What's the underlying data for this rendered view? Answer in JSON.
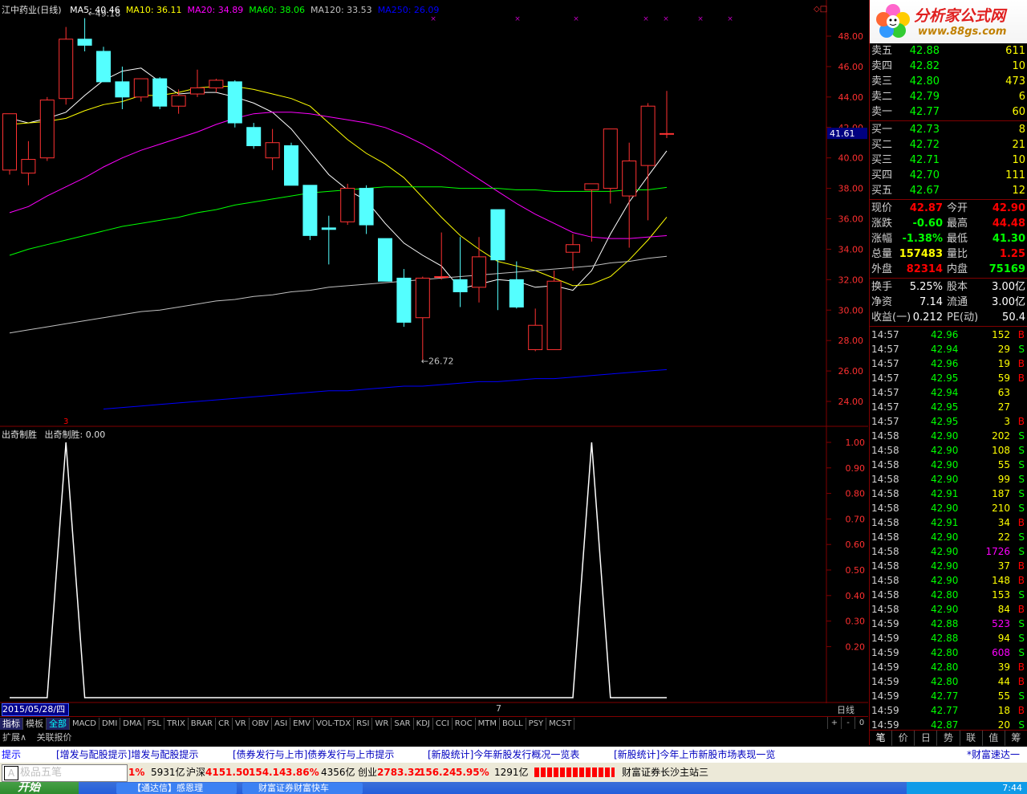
{
  "header": {
    "title": "江中药业(日线)",
    "ma": [
      {
        "label": "MA5: 40.46",
        "color": "#ffffff"
      },
      {
        "label": "MA10: 36.11",
        "color": "#ffff00"
      },
      {
        "label": "MA20: 34.89",
        "color": "#ff00ff"
      },
      {
        "label": "MA60: 38.06",
        "color": "#00ff00"
      },
      {
        "label": "MA120: 33.53",
        "color": "#c0c0c0"
      },
      {
        "label": "MA250: 26.09",
        "color": "#0000ff"
      }
    ]
  },
  "price_axis": [
    "48.00",
    "46.00",
    "44.00",
    "42.00",
    "40.00",
    "38.00",
    "36.00",
    "34.00",
    "32.00",
    "30.00",
    "28.00",
    "26.00",
    "24.00"
  ],
  "price_marker": "41.61",
  "annotations": {
    "high": "49.18",
    "low": "26.72"
  },
  "indicator": {
    "title": "出奇制胜",
    "value_label": "出奇制胜: 0.00",
    "axis": [
      "1.00",
      "0.90",
      "0.80",
      "0.70",
      "0.60",
      "0.50",
      "0.40",
      "0.30",
      "0.20"
    ],
    "signal_marker": "3"
  },
  "date_label": "2015/05/28/四",
  "month_marker": "7",
  "period_label": "日线",
  "chart_data": {
    "type": "candlestick",
    "title": "江中药业(日线)",
    "ylim": [
      23.0,
      49.5
    ],
    "candles": [
      {
        "o": 39.2,
        "h": 42.9,
        "l": 38.9,
        "c": 42.9
      },
      {
        "o": 39.0,
        "h": 41.1,
        "l": 38.2,
        "c": 39.9
      },
      {
        "o": 40.0,
        "h": 44.0,
        "l": 39.8,
        "c": 43.8
      },
      {
        "o": 43.9,
        "h": 48.6,
        "l": 43.5,
        "c": 47.8
      },
      {
        "o": 47.8,
        "h": 49.18,
        "l": 47.0,
        "c": 47.4
      },
      {
        "o": 47.0,
        "h": 47.3,
        "l": 45.0,
        "c": 45.0
      },
      {
        "o": 45.0,
        "h": 46.0,
        "l": 43.2,
        "c": 44.0
      },
      {
        "o": 44.0,
        "h": 45.2,
        "l": 43.7,
        "c": 45.2
      },
      {
        "o": 45.2,
        "h": 45.3,
        "l": 43.2,
        "c": 43.4
      },
      {
        "o": 43.4,
        "h": 44.5,
        "l": 42.9,
        "c": 44.1
      },
      {
        "o": 44.2,
        "h": 45.8,
        "l": 44.0,
        "c": 44.6
      },
      {
        "o": 44.6,
        "h": 45.2,
        "l": 44.3,
        "c": 45.1
      },
      {
        "o": 45.0,
        "h": 45.1,
        "l": 42.0,
        "c": 42.3
      },
      {
        "o": 42.0,
        "h": 42.3,
        "l": 40.6,
        "c": 40.8
      },
      {
        "o": 40.0,
        "h": 41.9,
        "l": 39.2,
        "c": 41.0
      },
      {
        "o": 40.8,
        "h": 41.0,
        "l": 38.2,
        "c": 38.2
      },
      {
        "o": 38.2,
        "h": 38.2,
        "l": 34.6,
        "c": 34.9
      },
      {
        "o": 35.4,
        "h": 36.2,
        "l": 33.0,
        "c": 35.3
      },
      {
        "o": 35.8,
        "h": 38.3,
        "l": 35.6,
        "c": 38.0
      },
      {
        "o": 38.0,
        "h": 38.2,
        "l": 35.0,
        "c": 35.6
      },
      {
        "o": 34.7,
        "h": 34.7,
        "l": 31.9,
        "c": 31.9
      },
      {
        "o": 32.1,
        "h": 32.7,
        "l": 28.9,
        "c": 29.2
      },
      {
        "o": 29.5,
        "h": 32.2,
        "l": 26.72,
        "c": 32.1
      },
      {
        "o": 32.2,
        "h": 35.1,
        "l": 32.0,
        "c": 32.2
      },
      {
        "o": 32.0,
        "h": 34.8,
        "l": 30.2,
        "c": 31.2
      },
      {
        "o": 31.5,
        "h": 34.8,
        "l": 30.5,
        "c": 33.5
      },
      {
        "o": 36.6,
        "h": 36.6,
        "l": 30.0,
        "c": 33.3
      },
      {
        "o": 32.0,
        "h": 33.2,
        "l": 30.1,
        "c": 30.2
      },
      {
        "o": 27.4,
        "h": 30.1,
        "l": 27.3,
        "c": 29.0
      },
      {
        "o": 27.4,
        "h": 32.6,
        "l": 27.4,
        "c": 31.9
      },
      {
        "o": 33.8,
        "h": 35.0,
        "l": 32.6,
        "c": 34.3
      },
      {
        "o": 37.9,
        "h": 38.3,
        "l": 34.5,
        "c": 38.3
      },
      {
        "o": 38.0,
        "h": 41.9,
        "l": 37.0,
        "c": 41.9
      },
      {
        "o": 37.5,
        "h": 41.0,
        "l": 34.1,
        "c": 39.8
      },
      {
        "o": 39.5,
        "h": 43.6,
        "l": 35.9,
        "c": 43.4
      },
      {
        "o": 41.6,
        "h": 44.4,
        "l": 41.3,
        "c": 41.6
      }
    ],
    "ma_lines": [
      {
        "name": "MA5",
        "color": "#ffffff",
        "values": [
          42.6,
          42.3,
          42.6,
          43.0,
          44.1,
          45.1,
          45.7,
          45.9,
          45.0,
          44.2,
          44.3,
          44.3,
          44.0,
          43.6,
          43.0,
          41.9,
          40.4,
          38.9,
          37.9,
          37.2,
          35.7,
          34.4,
          33.6,
          32.9,
          31.4,
          31.7,
          32.0,
          31.9,
          31.5,
          31.6,
          31.3,
          32.6,
          35.0,
          37.1,
          38.8,
          40.46
        ]
      },
      {
        "name": "MA10",
        "color": "#ffff00",
        "values": [
          42.2,
          42.3,
          42.4,
          42.6,
          43.1,
          43.5,
          43.7,
          44.1,
          44.1,
          44.3,
          44.6,
          44.7,
          44.7,
          44.5,
          44.2,
          43.9,
          43.4,
          42.3,
          41.2,
          40.3,
          39.6,
          38.7,
          37.4,
          36.1,
          34.9,
          34.0,
          33.2,
          32.9,
          32.6,
          32.1,
          31.6,
          31.7,
          32.2,
          33.3,
          34.6,
          36.11
        ]
      },
      {
        "name": "MA20",
        "color": "#ff00ff",
        "values": [
          36.4,
          36.8,
          37.5,
          38.1,
          38.7,
          39.4,
          40.0,
          40.5,
          40.9,
          41.3,
          41.7,
          42.2,
          42.6,
          42.9,
          43.0,
          43.0,
          42.9,
          42.7,
          42.5,
          42.3,
          42.0,
          41.5,
          40.9,
          40.2,
          39.4,
          38.6,
          37.8,
          37.0,
          36.3,
          35.7,
          35.1,
          34.8,
          34.7,
          34.7,
          34.8,
          34.89
        ]
      },
      {
        "name": "MA60",
        "color": "#00ff00",
        "values": [
          33.6,
          34.0,
          34.3,
          34.6,
          34.9,
          35.2,
          35.5,
          35.7,
          35.9,
          36.1,
          36.4,
          36.6,
          36.9,
          37.1,
          37.3,
          37.5,
          37.7,
          37.8,
          37.9,
          38.0,
          38.1,
          38.1,
          38.1,
          38.1,
          38.0,
          38.0,
          38.0,
          37.9,
          37.9,
          37.8,
          37.8,
          37.8,
          37.8,
          37.9,
          37.9,
          38.06
        ]
      },
      {
        "name": "MA120",
        "color": "#c0c0c0",
        "values": [
          28.5,
          28.7,
          28.9,
          29.1,
          29.3,
          29.5,
          29.7,
          29.9,
          30.0,
          30.2,
          30.4,
          30.6,
          30.7,
          30.9,
          31.0,
          31.2,
          31.3,
          31.5,
          31.6,
          31.7,
          31.8,
          31.9,
          32.0,
          32.1,
          32.2,
          32.3,
          32.4,
          32.5,
          32.6,
          32.7,
          32.8,
          32.9,
          33.1,
          33.2,
          33.4,
          33.53
        ]
      },
      {
        "name": "MA250",
        "color": "#0000ff",
        "values": [
          null,
          null,
          null,
          null,
          null,
          23.5,
          23.6,
          23.7,
          23.8,
          23.9,
          24.0,
          24.1,
          24.2,
          24.3,
          24.4,
          24.5,
          24.6,
          24.7,
          24.7,
          24.8,
          24.9,
          25.0,
          25.0,
          25.1,
          25.2,
          25.3,
          25.3,
          25.4,
          25.5,
          25.5,
          25.6,
          25.7,
          25.8,
          25.9,
          26.0,
          26.09
        ]
      }
    ],
    "indicator_series": {
      "name": "出奇制胜",
      "ylim": [
        0,
        1.05
      ],
      "values": [
        0,
        0,
        0,
        1,
        0,
        0,
        0,
        0,
        0,
        0,
        0,
        0,
        0,
        0,
        0,
        0,
        0,
        0,
        0,
        0,
        0,
        0,
        0,
        0,
        0,
        0,
        0,
        0,
        0,
        0,
        0,
        1,
        0,
        0,
        0,
        0
      ]
    }
  },
  "indicator_tabs": [
    "指标",
    "模板",
    "全部",
    "MACD",
    "DMI",
    "DMA",
    "FSL",
    "TRIX",
    "BRAR",
    "CR",
    "VR",
    "OBV",
    "ASI",
    "EMV",
    "VOL-TDX",
    "RSI",
    "WR",
    "SAR",
    "KDJ",
    "CCI",
    "ROC",
    "MTM",
    "BOLL",
    "PSY",
    "MCST"
  ],
  "tab_nav": [
    "+",
    "-",
    "0"
  ],
  "expand_labels": [
    "扩展∧",
    "关联报价"
  ],
  "logo": {
    "brand": "分析家公式网",
    "site": "www.88gs.com"
  },
  "order_book": {
    "asks": [
      {
        "label": "卖五",
        "price": "42.88",
        "vol": "611"
      },
      {
        "label": "卖四",
        "price": "42.82",
        "vol": "10"
      },
      {
        "label": "卖三",
        "price": "42.80",
        "vol": "473"
      },
      {
        "label": "卖二",
        "price": "42.79",
        "vol": "6"
      },
      {
        "label": "卖一",
        "price": "42.77",
        "vol": "60"
      }
    ],
    "bids": [
      {
        "label": "买一",
        "price": "42.73",
        "vol": "8"
      },
      {
        "label": "买二",
        "price": "42.72",
        "vol": "21"
      },
      {
        "label": "买三",
        "price": "42.71",
        "vol": "10"
      },
      {
        "label": "买四",
        "price": "42.70",
        "vol": "111"
      },
      {
        "label": "买五",
        "price": "42.67",
        "vol": "12"
      }
    ]
  },
  "quote": [
    {
      "l1": "现价",
      "v1": "42.87",
      "c1": "#ff0000",
      "l2": "今开",
      "v2": "42.90",
      "c2": "#ff0000"
    },
    {
      "l1": "涨跌",
      "v1": "-0.60",
      "c1": "#00ff00",
      "l2": "最高",
      "v2": "44.48",
      "c2": "#ff0000"
    },
    {
      "l1": "涨幅",
      "v1": "-1.38%",
      "c1": "#00ff00",
      "l2": "最低",
      "v2": "41.30",
      "c2": "#00ff00"
    },
    {
      "l1": "总量",
      "v1": "157483",
      "c1": "#ffff00",
      "l2": "量比",
      "v2": "1.25",
      "c2": "#ff0000"
    },
    {
      "l1": "外盘",
      "v1": "82314",
      "c1": "#ff0000",
      "l2": "内盘",
      "v2": "75169",
      "c2": "#00ff00"
    }
  ],
  "fundamentals": [
    {
      "l1": "换手",
      "v1": "5.25%",
      "l2": "股本",
      "v2": "3.00亿"
    },
    {
      "l1": "净资",
      "v1": "7.14",
      "l2": "流通",
      "v2": "3.00亿"
    },
    {
      "l1": "收益(一)",
      "v1": "0.212",
      "l2": "PE(动)",
      "v2": "50.4"
    }
  ],
  "ticks": [
    {
      "t": "14:57",
      "p": "42.96",
      "v": "152",
      "s": "B"
    },
    {
      "t": "14:57",
      "p": "42.94",
      "v": "29",
      "s": "S"
    },
    {
      "t": "14:57",
      "p": "42.96",
      "v": "19",
      "s": "B"
    },
    {
      "t": "14:57",
      "p": "42.95",
      "v": "59",
      "s": "B"
    },
    {
      "t": "14:57",
      "p": "42.94",
      "v": "63",
      "s": ""
    },
    {
      "t": "14:57",
      "p": "42.95",
      "v": "27",
      "s": ""
    },
    {
      "t": "14:57",
      "p": "42.95",
      "v": "3",
      "s": "B"
    },
    {
      "t": "14:58",
      "p": "42.90",
      "v": "202",
      "s": "S"
    },
    {
      "t": "14:58",
      "p": "42.90",
      "v": "108",
      "s": "S"
    },
    {
      "t": "14:58",
      "p": "42.90",
      "v": "55",
      "s": "S"
    },
    {
      "t": "14:58",
      "p": "42.90",
      "v": "99",
      "s": "S"
    },
    {
      "t": "14:58",
      "p": "42.91",
      "v": "187",
      "s": "S"
    },
    {
      "t": "14:58",
      "p": "42.90",
      "v": "210",
      "s": "S"
    },
    {
      "t": "14:58",
      "p": "42.91",
      "v": "34",
      "s": "B"
    },
    {
      "t": "14:58",
      "p": "42.90",
      "v": "22",
      "s": "S"
    },
    {
      "t": "14:58",
      "p": "42.90",
      "v": "1726",
      "s": "S"
    },
    {
      "t": "14:58",
      "p": "42.90",
      "v": "37",
      "s": "B"
    },
    {
      "t": "14:58",
      "p": "42.90",
      "v": "148",
      "s": "B"
    },
    {
      "t": "14:58",
      "p": "42.80",
      "v": "153",
      "s": "S"
    },
    {
      "t": "14:58",
      "p": "42.90",
      "v": "84",
      "s": "B"
    },
    {
      "t": "14:59",
      "p": "42.88",
      "v": "523",
      "s": "S"
    },
    {
      "t": "14:59",
      "p": "42.88",
      "v": "94",
      "s": "S"
    },
    {
      "t": "14:59",
      "p": "42.80",
      "v": "608",
      "s": "S"
    },
    {
      "t": "14:59",
      "p": "42.80",
      "v": "39",
      "s": "B"
    },
    {
      "t": "14:59",
      "p": "42.80",
      "v": "44",
      "s": "B"
    },
    {
      "t": "14:59",
      "p": "42.77",
      "v": "55",
      "s": "S"
    },
    {
      "t": "14:59",
      "p": "42.77",
      "v": "18",
      "s": "B"
    },
    {
      "t": "14:59",
      "p": "42.87",
      "v": "20",
      "s": "S"
    }
  ],
  "right_tabs": [
    "笔",
    "价",
    "日",
    "势",
    "联",
    "值",
    "筹"
  ],
  "news": {
    "prefix": "提示",
    "items": [
      "[增发与配股提示]增发与配股提示",
      "[债券发行与上市]债券发行与上市提示",
      "[新股统计]今年新股发行概况一览表",
      "[新股统计]今年上市新股市场表现一览"
    ],
    "tail": "*财富速达一"
  },
  "status": {
    "ime": "极品五笔",
    "seg1": "1%",
    "seg2": "5931亿",
    "hs_label": "沪深",
    "hs_val": "4151.50",
    "hs_chg": "154.14",
    "hs_pct": "3.86%",
    "seg3": "4356亿",
    "cy_label": "创业",
    "cy_val": "2783.32",
    "cy_chg": "156.24",
    "cy_pct": "5.95%",
    "seg4": "1291亿",
    "broker": "财富证券长沙主站三"
  },
  "taskbar": {
    "start": "开始",
    "tasks": [
      "【通达信】感恩理",
      "财富证券财富快车"
    ],
    "clock": "7:44"
  }
}
